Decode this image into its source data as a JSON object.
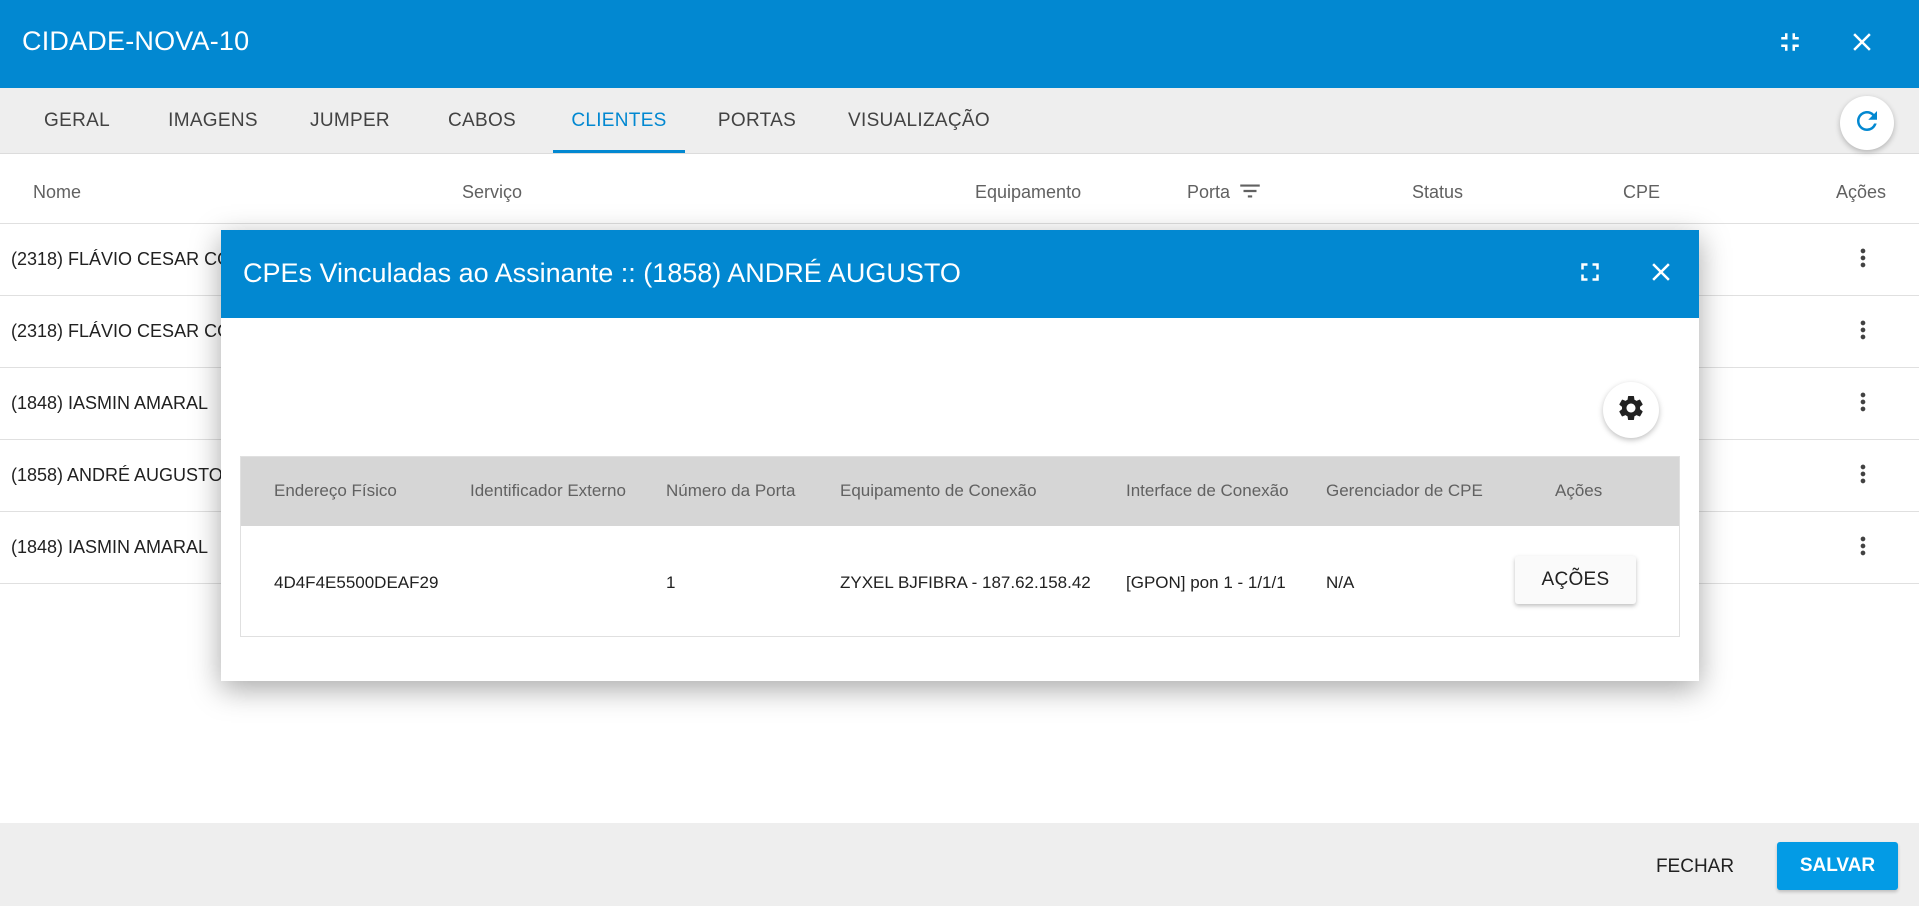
{
  "window": {
    "title": "CIDADE-NOVA-10",
    "icons": {
      "exit_fullscreen": "fullscreen-exit-icon",
      "close": "close-icon"
    }
  },
  "tabs": [
    {
      "label": "GERAL",
      "active": false
    },
    {
      "label": "IMAGENS",
      "active": false
    },
    {
      "label": "JUMPER",
      "active": false
    },
    {
      "label": "CABOS",
      "active": false
    },
    {
      "label": "CLIENTES",
      "active": true
    },
    {
      "label": "PORTAS",
      "active": false
    },
    {
      "label": "VISUALIZAÇÃO",
      "active": false
    }
  ],
  "clients_table": {
    "columns": [
      "Nome",
      "Serviço",
      "Equipamento",
      "Porta",
      "Status",
      "CPE",
      "Ações"
    ],
    "rows": [
      {
        "name": "(2318) FLÁVIO CESAR COS"
      },
      {
        "name": "(2318) FLÁVIO CESAR COS"
      },
      {
        "name": "(1848) IASMIN AMARAL"
      },
      {
        "name": "(1858) ANDRÉ AUGUSTO"
      },
      {
        "name": "(1848) IASMIN AMARAL"
      }
    ]
  },
  "footer": {
    "close_label": "FECHAR",
    "save_label": "SALVAR"
  },
  "modal": {
    "title": "CPEs Vinculadas ao Assinante :: (1858) ANDRÉ AUGUSTO",
    "table": {
      "columns": [
        "Endereço Físico",
        "Identificador Externo",
        "Número da Porta",
        "Equipamento de Conexão",
        "Interface de Conexão",
        "Gerenciador de CPE",
        "Ações"
      ],
      "rows": [
        {
          "mac": "4D4F4E5500DEAF29",
          "external_id": "",
          "port_number": "1",
          "equipment": "ZYXEL BJFIBRA - 187.62.158.42",
          "interface": "[GPON] pon 1 - 1/1/1",
          "manager": "N/A",
          "actions_label": "AÇÕES"
        }
      ]
    }
  },
  "colors": {
    "primary": "#0288d1",
    "save_button": "#039be5",
    "tab_bar": "#eeeeee",
    "table_header": "#d6d6d6"
  }
}
